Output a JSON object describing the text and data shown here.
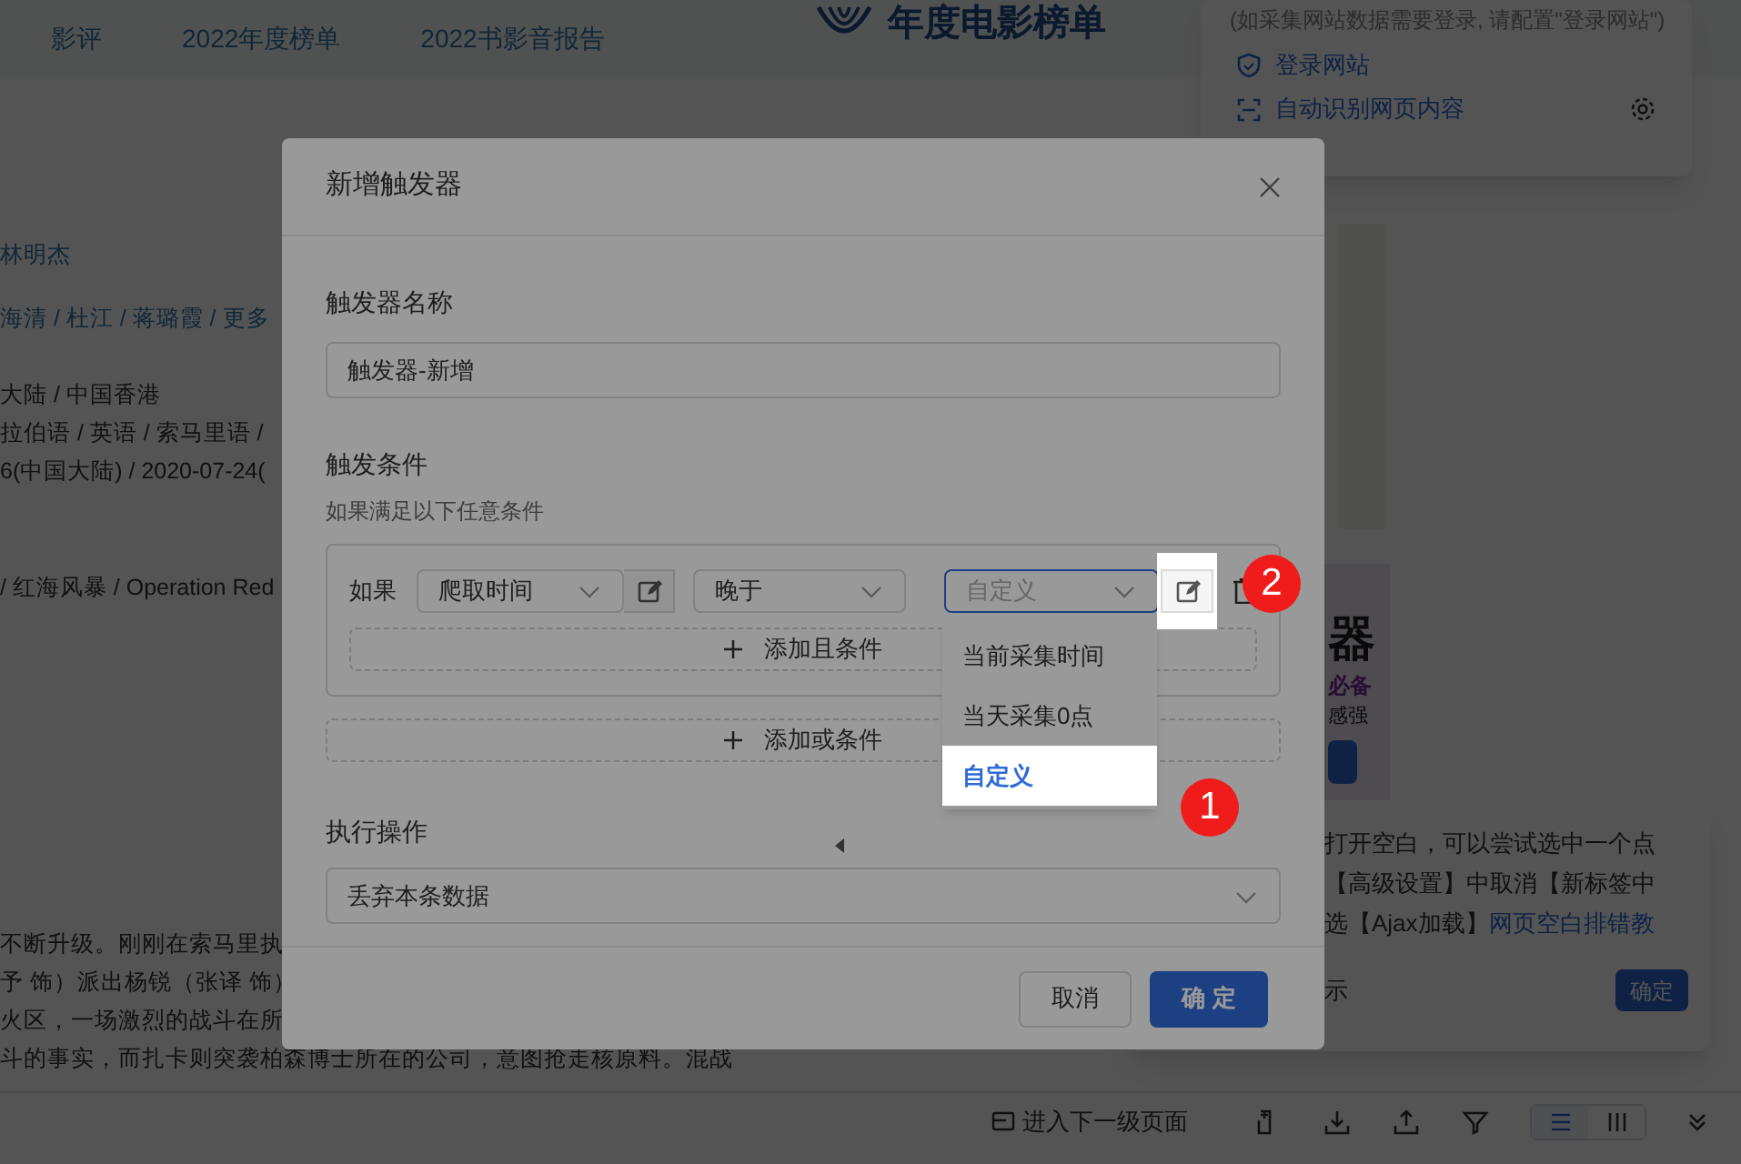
{
  "site_nav": {
    "links": [
      "影评",
      "2022年度榜单",
      "2022书影音报告"
    ],
    "banner_title": "年度电影榜单"
  },
  "login_panel": {
    "hint": "(如采集网站数据需要登录, 请配置\"登录网站\")",
    "items": [
      {
        "label": "登录网站",
        "kind": "login"
      },
      {
        "label": "自动识别网页内容",
        "kind": "detect"
      }
    ]
  },
  "movie_info": {
    "lines": [
      {
        "text": "林明杰",
        "kind": "link"
      },
      {
        "text": "海清 / 杜江 / 蒋璐霞 / 更多",
        "kind": "link"
      },
      {
        "text": "大陆 / 中国香港",
        "kind": "text"
      },
      {
        "text": "拉伯语 / 英语 / 索马里语 /",
        "kind": "text"
      },
      {
        "text": "6(中国大陆) / 2020-07-24(",
        "kind": "text"
      },
      {
        "text": "/ 红海风暴 / Operation Red",
        "kind": "text"
      }
    ],
    "synopsis": [
      "不断升级。刚刚在索马里执",
      "予 饰）派出杨锐（张译 饰）",
      "火区，一场激烈的战斗在所",
      "斗的事实，而扎卡则突袭柏森博士所在的公司，意图抢走核原料。混战"
    ]
  },
  "ad": {
    "title": "器",
    "tagline": "必备",
    "note": "感强"
  },
  "tip_popup": {
    "lines": [
      "打开空白，可以尝试选中一个点",
      "【高级设置】中取消【新标签中"
    ],
    "last_line": "选【Ajax加载】",
    "link": "网页空白排错教",
    "footer": "示",
    "button": "确定"
  },
  "dialog": {
    "title": "新增触发器",
    "name_label": "触发器名称",
    "name_value": "触发器-新增",
    "condition_label": "触发条件",
    "condition_hint": "如果满足以下任意条件",
    "condition": {
      "prefix": "如果",
      "field": "爬取时间",
      "operator": "晚于",
      "value_placeholder": "自定义",
      "value_focused": true,
      "add_and": "添加且条件"
    },
    "add_or": "添加或条件",
    "value_options": [
      {
        "label": "当前采集时间",
        "selected": false
      },
      {
        "label": "当天采集0点",
        "selected": false
      },
      {
        "label": "自定义",
        "selected": true
      }
    ],
    "action_label": "执行操作",
    "action_value": "丢弃本条数据",
    "cancel": "取消",
    "confirm": "确 定"
  },
  "guide_steps": [
    "1",
    "2"
  ],
  "toolbar": {
    "next_page": "进入下一级页面",
    "view_modes": [
      {
        "kind": "list",
        "selected": true
      },
      {
        "kind": "columns",
        "selected": false
      }
    ]
  }
}
